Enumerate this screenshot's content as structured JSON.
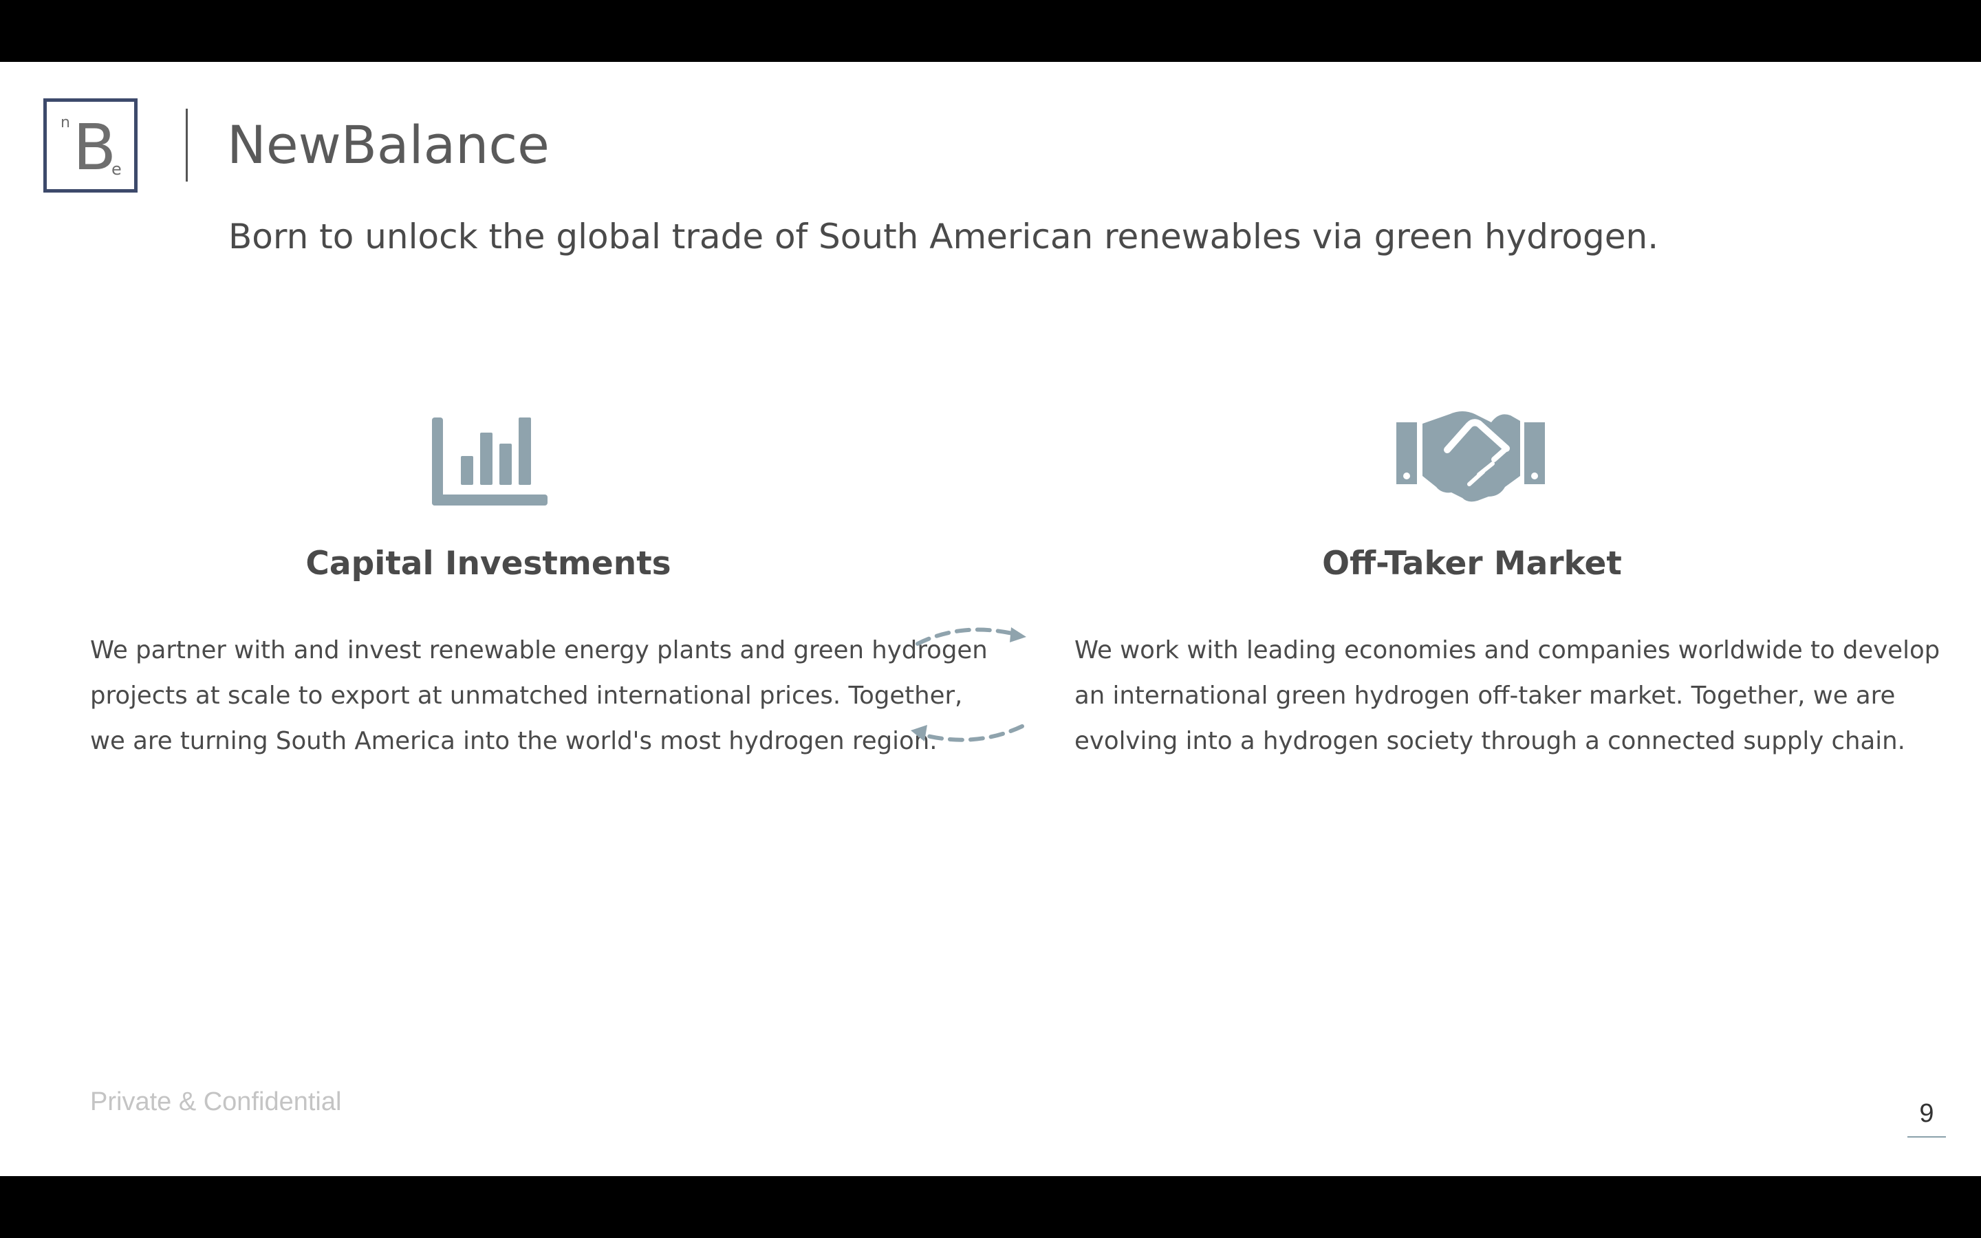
{
  "header": {
    "logo": {
      "big_letter": "B",
      "small_top": "n",
      "small_bottom": "e",
      "border_color": "#3d4a6b"
    },
    "brand_title": "NewBalance",
    "tagline": "Born to unlock the global trade of South American renewables via green hydrogen."
  },
  "columns": [
    {
      "icon": "bar-chart-icon",
      "heading": "Capital Investments",
      "body_lines": [
        "We partner with and invest renewable energy plants and green hydrogen",
        "projects at scale to export at unmatched international prices. Together,",
        "we are turning South America into the world's most hydrogen region."
      ]
    },
    {
      "icon": "handshake-icon",
      "heading": "Off-Taker Market",
      "body_lines": [
        "We work with leading economies and companies worldwide to develop",
        "an international green hydrogen off-taker market. Together, we are",
        "evolving into a hydrogen society through a connected supply chain."
      ]
    }
  ],
  "connector_icon": "exchange-arrows-icon",
  "footer": {
    "confidential": "Private & Confidential",
    "page_number": "9"
  },
  "colors": {
    "icon": "#8fa3ad",
    "text": "#4a4a4a",
    "footer_text": "#c4c4c4",
    "background": "#ffffff",
    "letterbox": "#000000"
  }
}
